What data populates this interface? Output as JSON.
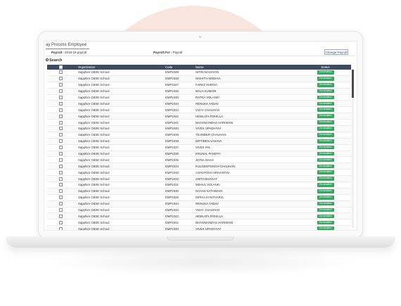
{
  "page": {
    "title": "ay Process Employee",
    "payroll_label": "Payroll :",
    "payroll_value": "2018-19 payroll",
    "payroll_for_label": "Payroll For :",
    "payroll_for_value": "Payroll",
    "change_button": "Change Payroll",
    "search_label": "Search"
  },
  "table": {
    "headers": {
      "organization": "Organization",
      "code": "Code",
      "name": "Name",
      "status": "Status"
    },
    "rows": [
      {
        "org": "Sapphire CBSE School",
        "code": "EMP1049",
        "name": "NITIN MAHAYAN",
        "status": "Generated"
      },
      {
        "org": "Sapphire CBSE School",
        "code": "EMP1048",
        "name": "NISHITH MODHIA",
        "status": "Generated"
      },
      {
        "org": "Sapphire CBSE School",
        "code": "EMP1047",
        "name": "FAREZ SHIRSA",
        "status": "Generated"
      },
      {
        "org": "Sapphire CBSE School",
        "code": "EMP1046",
        "name": "MALA KUMARI",
        "status": "Generated"
      },
      {
        "org": "Sapphire CBSE School",
        "code": "EMP1045",
        "name": "RATNA SOLANKI",
        "status": "Generated"
      },
      {
        "org": "Sapphire CBSE School",
        "code": "EMP1044",
        "name": "RENUKA YADAV",
        "status": "Generated"
      },
      {
        "org": "Sapphire CBSE School",
        "code": "EMP1043",
        "name": "VIJAY CHAUHAN",
        "status": "Generated"
      },
      {
        "org": "Sapphire CBSE School",
        "code": "EMP1042",
        "name": "HEMLATA ROHILLA",
        "status": "Generated"
      },
      {
        "org": "Sapphire CBSE School",
        "code": "EMP1041",
        "name": "BHAGWANDAS HARIWANI",
        "status": "Generated"
      },
      {
        "org": "Sapphire CBSE School",
        "code": "EMP1040",
        "name": "VIVEK UPADHYAY",
        "status": "Generated"
      },
      {
        "org": "Sapphire CBSE School",
        "code": "EMP1039",
        "name": "TEJINDER CHAUHAN",
        "status": "Generated"
      },
      {
        "org": "Sapphire CBSE School",
        "code": "EMP1038",
        "name": "DIPTIBEN VASAVA",
        "status": "Generated"
      },
      {
        "org": "Sapphire CBSE School",
        "code": "EMP1037",
        "name": "VIVEK PAL",
        "status": "Generated"
      },
      {
        "org": "Sapphire CBSE School",
        "code": "EMP1036",
        "name": "KRUNAL PANDYA",
        "status": "Generated"
      },
      {
        "org": "Sapphire CBSE School",
        "code": "EMP1035",
        "name": "JIGNA SHAH",
        "status": "Generated"
      },
      {
        "org": "Sapphire CBSE School",
        "code": "EMP1034",
        "name": "KULDEEPSINGH CHAUHAN",
        "status": "Generated"
      },
      {
        "org": "Sapphire CBSE School",
        "code": "EMP1033",
        "name": "ASHUTOSH SRIVASTAV",
        "status": "Generated"
      },
      {
        "org": "Sapphire CBSE School",
        "code": "EMP1032",
        "name": "ANITA BHAGAT",
        "status": "Generated"
      },
      {
        "org": "Sapphire CBSE School",
        "code": "EMP1031",
        "name": "MEHUL SOLANKI",
        "status": "Generated"
      },
      {
        "org": "Sapphire CBSE School",
        "code": "EMP1030",
        "name": "NAYAN NATHWANI",
        "status": "Generated"
      },
      {
        "org": "Sapphire CBSE School",
        "code": "EMP1025",
        "name": "DIPIKA KANTHARIA",
        "status": "Generated"
      },
      {
        "org": "Sapphire CBSE School",
        "code": "EMP1044",
        "name": "RENUKA YADAV",
        "status": "Generated"
      },
      {
        "org": "Sapphire CBSE School",
        "code": "EMP1043",
        "name": "VIJAY CHAUHAN",
        "status": "Generated"
      },
      {
        "org": "Sapphire CBSE School",
        "code": "EMP1042",
        "name": "HEMLATA ROHILLA",
        "status": "Generated"
      },
      {
        "org": "Sapphire CBSE School",
        "code": "EMP1041",
        "name": "BHAGWANDAS HARIWANI",
        "status": "Generated"
      },
      {
        "org": "Sapphire CBSE School",
        "code": "EMP1040",
        "name": "VIVEK UPADHYAY",
        "status": "Generated"
      }
    ]
  },
  "colors": {
    "header": "#3d4a63",
    "badge": "#3aa561",
    "accent_circle": "#f8e6df"
  }
}
